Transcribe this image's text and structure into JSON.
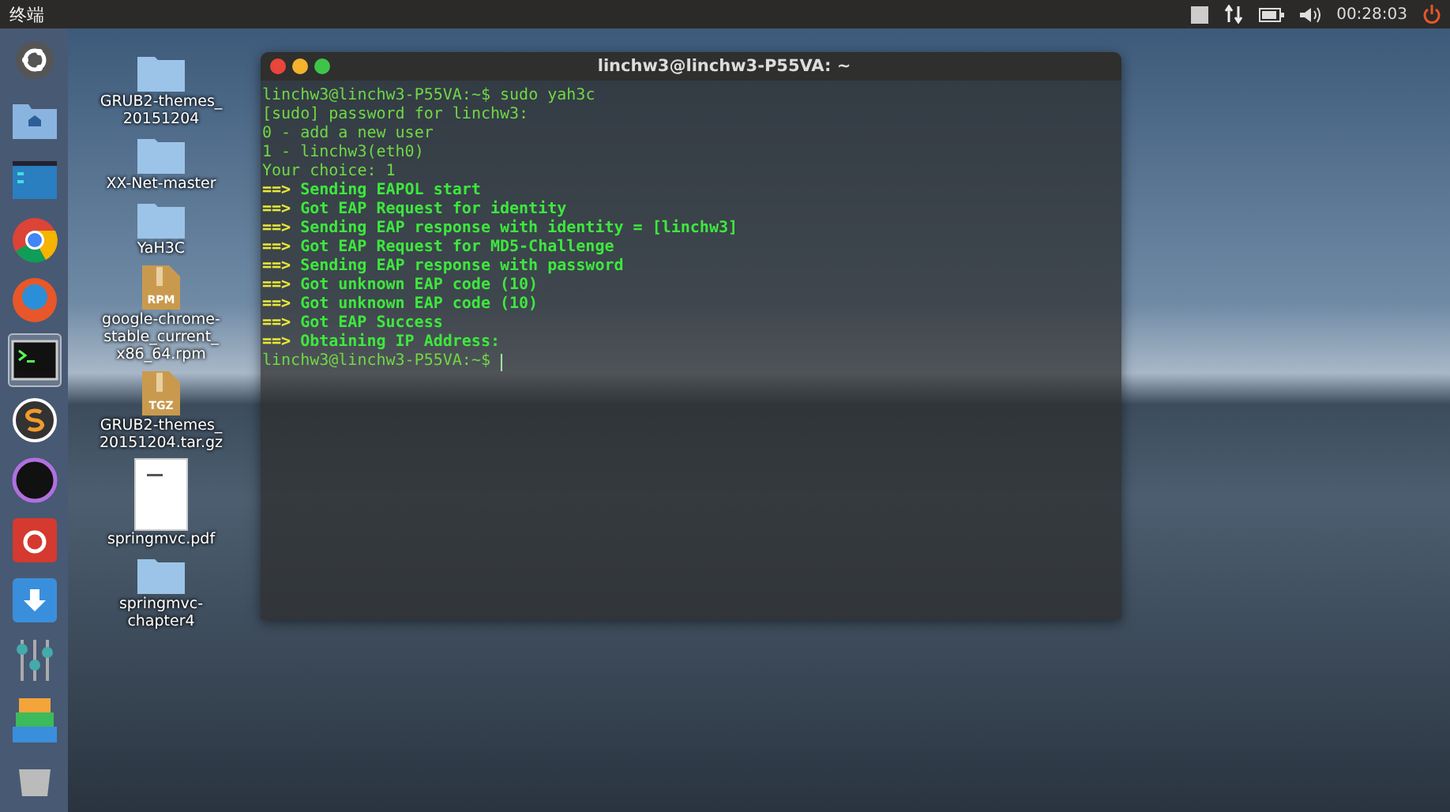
{
  "top_bar": {
    "title": "终端",
    "clock": "00:28:03"
  },
  "launcher": {
    "items": [
      {
        "kind": "dash",
        "selected": false
      },
      {
        "kind": "home",
        "selected": false
      },
      {
        "kind": "files",
        "selected": false
      },
      {
        "kind": "chrome",
        "selected": false
      },
      {
        "kind": "firefox",
        "selected": false
      },
      {
        "kind": "terminal",
        "selected": true
      },
      {
        "kind": "sublime",
        "selected": false
      },
      {
        "kind": "ring",
        "selected": false
      },
      {
        "kind": "music",
        "selected": false
      },
      {
        "kind": "download",
        "selected": false
      },
      {
        "kind": "mixer",
        "selected": false
      },
      {
        "kind": "stack",
        "selected": false
      },
      {
        "kind": "trash",
        "selected": false
      }
    ]
  },
  "desktop_icons": [
    {
      "kind": "folder",
      "label": "GRUB2-themes_ 20151204"
    },
    {
      "kind": "folder",
      "label": "XX-Net-master"
    },
    {
      "kind": "folder",
      "label": "YaH3C"
    },
    {
      "kind": "rpm",
      "label": "google-chrome- stable_current_ x86_64.rpm",
      "badge": "RPM"
    },
    {
      "kind": "tgz",
      "label": "GRUB2-themes_ 20151204.tar.gz",
      "badge": "TGZ"
    },
    {
      "kind": "pdf",
      "label": "springmvc.pdf"
    },
    {
      "kind": "folder",
      "label": "springmvc- chapter4"
    }
  ],
  "terminal": {
    "title": "linchw3@linchw3-P55VA: ~",
    "lines": [
      {
        "kind": "plain",
        "text": "linchw3@linchw3-P55VA:~$ sudo yah3c"
      },
      {
        "kind": "plain",
        "text": "[sudo] password for linchw3:"
      },
      {
        "kind": "plain",
        "text": "0 - add a new user"
      },
      {
        "kind": "plain",
        "text": "1 - linchw3(eth0)"
      },
      {
        "kind": "plain",
        "text": "Your choice: 1"
      },
      {
        "kind": "status",
        "arrow": "==>",
        "text": "Sending EAPOL start"
      },
      {
        "kind": "status",
        "arrow": "==>",
        "text": "Got EAP Request for identity"
      },
      {
        "kind": "status",
        "arrow": "==>",
        "text": "Sending EAP response with identity = [linchw3]"
      },
      {
        "kind": "status",
        "arrow": "==>",
        "text": "Got EAP Request for MD5-Challenge"
      },
      {
        "kind": "status",
        "arrow": "==>",
        "text": "Sending EAP response with password"
      },
      {
        "kind": "status",
        "arrow": "==>",
        "text": "Got unknown EAP code (10)"
      },
      {
        "kind": "status",
        "arrow": "==>",
        "text": "Got unknown EAP code (10)"
      },
      {
        "kind": "status",
        "arrow": "==>",
        "text": "Got EAP Success"
      },
      {
        "kind": "status",
        "arrow": "==>",
        "text": "Obtaining IP Address:"
      },
      {
        "kind": "prompt",
        "text": "linchw3@linchw3-P55VA:~$"
      }
    ]
  }
}
